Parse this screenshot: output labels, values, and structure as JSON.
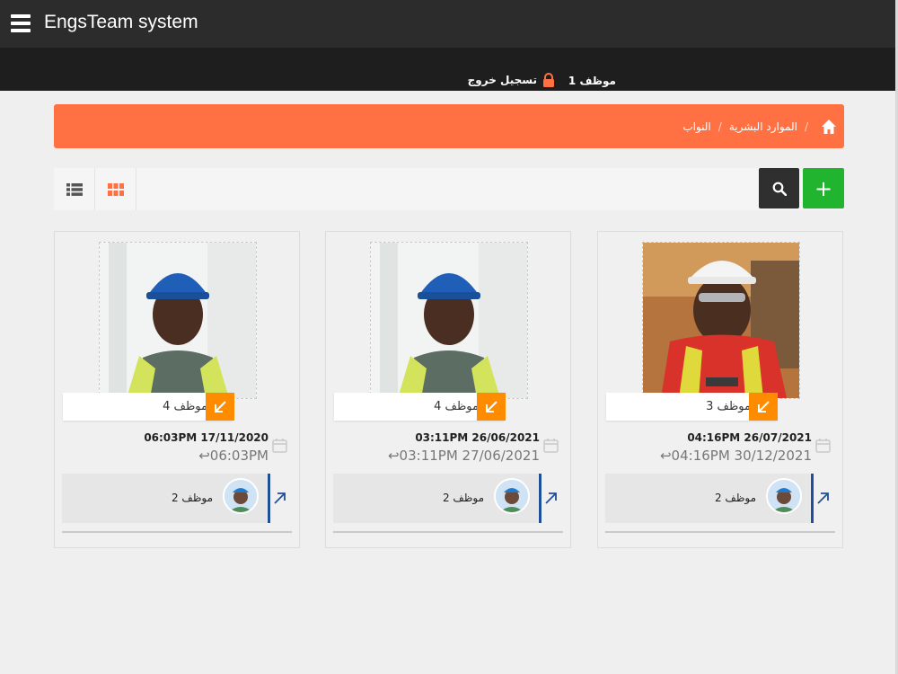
{
  "app": {
    "title": "EngsTeam system"
  },
  "userbar": {
    "user_name": "موظف 1",
    "logout_label": "تسجيل خروج"
  },
  "breadcrumb": {
    "items": [
      "الموارد البشرية",
      "النواب"
    ]
  },
  "icons": {
    "menu": "hamburger-icon",
    "lock": "lock-icon",
    "home": "home-icon",
    "list_view": "list-view-icon",
    "grid_view": "grid-view-icon",
    "search": "search-icon",
    "add": "plus-icon",
    "calendar": "calendar-icon",
    "return": "return-arrow-icon",
    "swap": "arrow-down-left-icon",
    "open": "arrow-up-right-icon"
  },
  "colors": {
    "topbar": "#2c2c2c",
    "userbar": "#1e1e1e",
    "breadcrumb_bg": "#ff7043",
    "add_button": "#21b42e",
    "search_button": "#2f2f2f",
    "arrow_badge": "#ff8c00",
    "assignee_accent": "#1f4e9a",
    "grid_icon": "#ff7043"
  },
  "toolbar": {
    "add_label": "+"
  },
  "cards": [
    {
      "employee": "موظف 3",
      "start": "04:16PM 26/07/2021",
      "end": "04:16PM 30/12/2021",
      "assignee": "موظف 2"
    },
    {
      "employee": "موظف 4",
      "start": "03:11PM 26/06/2021",
      "end": "03:11PM 27/06/2021",
      "assignee": "موظف 2"
    },
    {
      "employee": "موظف 4",
      "start": "06:03PM 17/11/2020",
      "end": "06:03PM",
      "assignee": "موظف 2"
    }
  ]
}
